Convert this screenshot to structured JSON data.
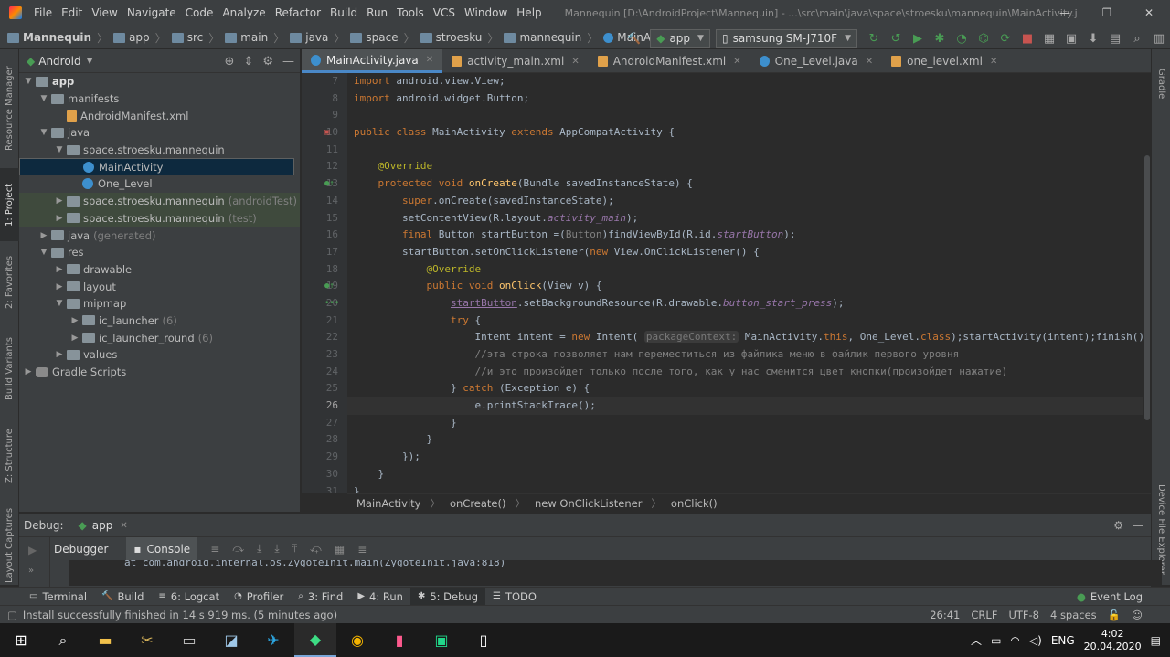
{
  "menu": {
    "items": [
      "File",
      "Edit",
      "View",
      "Navigate",
      "Code",
      "Analyze",
      "Refactor",
      "Build",
      "Run",
      "Tools",
      "VCS",
      "Window",
      "Help"
    ],
    "title": "Mannequin [D:\\AndroidProject\\Mannequin] - ...\\src\\main\\java\\space\\stroesku\\mannequin\\MainActivity.java [app]"
  },
  "nav": {
    "crumbs": [
      "Mannequin",
      "app",
      "src",
      "main",
      "java",
      "space",
      "stroesku",
      "mannequin",
      "MainActivity"
    ],
    "run_config": "app",
    "device": "samsung SM-J710F"
  },
  "left_stripe": [
    "Resource Manager",
    "1: Project",
    "2: Favorites",
    "Build Variants",
    "Z: Structure",
    "Layout Captures"
  ],
  "right_stripe": [
    "Gradle",
    "Device File Explorer"
  ],
  "project": {
    "view_mode": "Android",
    "tree": [
      {
        "label": "app",
        "hint": "",
        "kind": "folder",
        "depth": 0,
        "expanded": true
      },
      {
        "label": "manifests",
        "hint": "",
        "kind": "folder",
        "depth": 1,
        "expanded": true
      },
      {
        "label": "AndroidManifest.xml",
        "hint": "",
        "kind": "xml",
        "depth": 2,
        "expanded": null
      },
      {
        "label": "java",
        "hint": "",
        "kind": "folder",
        "depth": 1,
        "expanded": true
      },
      {
        "label": "space.stroesku.mannequin",
        "hint": "",
        "kind": "folder",
        "depth": 2,
        "expanded": true
      },
      {
        "label": "MainActivity",
        "hint": "",
        "kind": "class",
        "depth": 3,
        "expanded": null,
        "selected": true
      },
      {
        "label": "One_Level",
        "hint": "",
        "kind": "class",
        "depth": 3,
        "expanded": null
      },
      {
        "label": "space.stroesku.mannequin",
        "hint": "(androidTest)",
        "kind": "folder",
        "depth": 2,
        "expanded": false,
        "test": true
      },
      {
        "label": "space.stroesku.mannequin",
        "hint": "(test)",
        "kind": "folder",
        "depth": 2,
        "expanded": false,
        "test": true
      },
      {
        "label": "java",
        "hint": "(generated)",
        "kind": "folder",
        "depth": 1,
        "expanded": false
      },
      {
        "label": "res",
        "hint": "",
        "kind": "folder",
        "depth": 1,
        "expanded": true
      },
      {
        "label": "drawable",
        "hint": "",
        "kind": "folder",
        "depth": 2,
        "expanded": false
      },
      {
        "label": "layout",
        "hint": "",
        "kind": "folder",
        "depth": 2,
        "expanded": false
      },
      {
        "label": "mipmap",
        "hint": "",
        "kind": "folder",
        "depth": 2,
        "expanded": true
      },
      {
        "label": "ic_launcher",
        "hint": "(6)",
        "kind": "folder",
        "depth": 3,
        "expanded": false
      },
      {
        "label": "ic_launcher_round",
        "hint": "(6)",
        "kind": "folder",
        "depth": 3,
        "expanded": false
      },
      {
        "label": "values",
        "hint": "",
        "kind": "folder",
        "depth": 2,
        "expanded": false
      },
      {
        "label": "Gradle Scripts",
        "hint": "",
        "kind": "gradle",
        "depth": 0,
        "expanded": false
      }
    ]
  },
  "editor_tabs": [
    {
      "label": "MainActivity.java",
      "active": true,
      "kind": "class"
    },
    {
      "label": "activity_main.xml",
      "active": false,
      "kind": "xml"
    },
    {
      "label": "AndroidManifest.xml",
      "active": false,
      "kind": "xml"
    },
    {
      "label": "One_Level.java",
      "active": false,
      "kind": "class"
    },
    {
      "label": "one_level.xml",
      "active": false,
      "kind": "xml"
    }
  ],
  "code_lines": [
    {
      "n": "7",
      "html": "<span class=\"kw\">import</span> android.view.View;"
    },
    {
      "n": "8",
      "html": "<span class=\"kw\">import</span> android.widget.Button;"
    },
    {
      "n": "9",
      "html": ""
    },
    {
      "n": "10",
      "html": "<span class=\"kw\">public class</span> MainActivity <span class=\"kw\">extends</span> AppCompatActivity {"
    },
    {
      "n": "11",
      "html": ""
    },
    {
      "n": "12",
      "html": "    <span class=\"an\">@Override</span>"
    },
    {
      "n": "13",
      "html": "    <span class=\"kw\">protected void</span> <span class=\"fn\">onCreate</span>(Bundle savedInstanceState) {"
    },
    {
      "n": "14",
      "html": "        <span class=\"kw\">super</span>.onCreate(savedInstanceState);"
    },
    {
      "n": "15",
      "html": "        setContentView(R.layout.<span class=\"fld\">activity_main</span>);"
    },
    {
      "n": "16",
      "html": "        <span class=\"kw\">final</span> Button startButton =(<span class=\"cm\">Button</span>)findViewById(R.id.<span class=\"fld\">startButton</span>);"
    },
    {
      "n": "17",
      "html": "        startButton.setOnClickListener(<span class=\"kw\">new</span> View.OnClickListener() {"
    },
    {
      "n": "18",
      "html": "            <span class=\"an\">@Override</span>"
    },
    {
      "n": "19",
      "html": "            <span class=\"kw\">public void</span> <span class=\"fn\">onClick</span>(View v) {"
    },
    {
      "n": "20",
      "html": "                <span class=\"pl ul\">startButton</span>.setBackgroundResource(R.drawable.<span class=\"fld\">button_start_press</span>);"
    },
    {
      "n": "21",
      "html": "                <span class=\"kw\">try</span> {"
    },
    {
      "n": "22",
      "html": "                    Intent intent = <span class=\"kw\">new</span> Intent( <span class=\"ph\">packageContext:</span> MainActivity.<span class=\"kw\">this</span>, One_Level.<span class=\"kw\">class</span>);startActivity(intent);finish();"
    },
    {
      "n": "23",
      "html": "                    <span class=\"cm\">//эта строка позволяет нам переместиться из файлика меню в файлик первого уровня</span>"
    },
    {
      "n": "24",
      "html": "                    <span class=\"cm\">//и это произойдет только после того, как у нас сменится цвет кнопки(произойдет нажатие)</span>"
    },
    {
      "n": "25",
      "html": "                } <span class=\"kw\">catch</span> (Exception e) {"
    },
    {
      "n": "26",
      "html": "                    e.printStackTrace();",
      "current": true
    },
    {
      "n": "27",
      "html": "                }"
    },
    {
      "n": "28",
      "html": "            }"
    },
    {
      "n": "29",
      "html": "        });"
    },
    {
      "n": "30",
      "html": "    }"
    },
    {
      "n": "31",
      "html": "}"
    }
  ],
  "editor_breadcrumbs": [
    "MainActivity",
    "onCreate()",
    "new OnClickListener",
    "onClick()"
  ],
  "debug": {
    "label": "Debug:",
    "session": "app",
    "tabs": [
      "Debugger",
      "Console"
    ],
    "console_line": "    at com.android.internal.os.ZygoteInit.main(ZygoteInit.java:818)"
  },
  "tool_tabs": [
    {
      "label": "Terminal",
      "icon": "terminal-icon"
    },
    {
      "label": "Build",
      "icon": "build-icon"
    },
    {
      "label": "6: Logcat",
      "icon": "logcat-icon"
    },
    {
      "label": "Profiler",
      "icon": "profiler-icon"
    },
    {
      "label": "3: Find",
      "icon": "search-icon"
    },
    {
      "label": "4: Run",
      "icon": "run-icon"
    },
    {
      "label": "5: Debug",
      "icon": "debug-icon",
      "active": true
    },
    {
      "label": "TODO",
      "icon": "todo-icon"
    }
  ],
  "event_log": "Event Log",
  "status": {
    "message": "Install successfully finished in 14 s 919 ms. (5 minutes ago)",
    "position": "26:41",
    "line_sep": "CRLF",
    "encoding": "UTF-8",
    "indent": "4 spaces"
  },
  "taskbar": {
    "lang": "ENG",
    "time": "4:02",
    "date": "20.04.2020"
  }
}
